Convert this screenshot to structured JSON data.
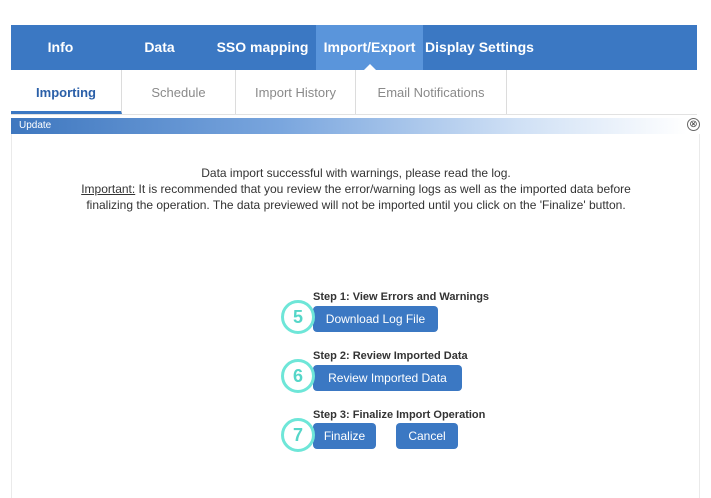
{
  "nav": {
    "tabs": [
      {
        "label": "Info"
      },
      {
        "label": "Data"
      },
      {
        "label": "SSO mapping"
      },
      {
        "label": "Import/Export"
      },
      {
        "label": "Display Settings"
      }
    ],
    "active": "Import/Export"
  },
  "subnav": {
    "tabs": [
      {
        "label": "Importing"
      },
      {
        "label": "Schedule"
      },
      {
        "label": "Import History"
      },
      {
        "label": "Email Notifications"
      }
    ],
    "active": "Importing"
  },
  "update_bar": {
    "title": "Update",
    "close_icon": "⊗"
  },
  "message": {
    "line1": "Data import successful with warnings, please read the log.",
    "important_label": "Important:",
    "body": " It is recommended that you review the error/warning logs as well as the imported data before finalizing the operation. The data previewed will not be imported until you click on the 'Finalize' button."
  },
  "steps": [
    {
      "number": "5",
      "label": "Step 1: View Errors and Warnings",
      "button": "Download Log File"
    },
    {
      "number": "6",
      "label": "Step 2: Review Imported Data",
      "button": "Review Imported Data"
    },
    {
      "number": "7",
      "label": "Step 3: Finalize Import Operation",
      "button": "Finalize",
      "secondary_button": "Cancel"
    }
  ],
  "colors": {
    "accent": "#3b78c3",
    "nav_active": "#5a95db",
    "step_badge": "#6ee6d8"
  }
}
